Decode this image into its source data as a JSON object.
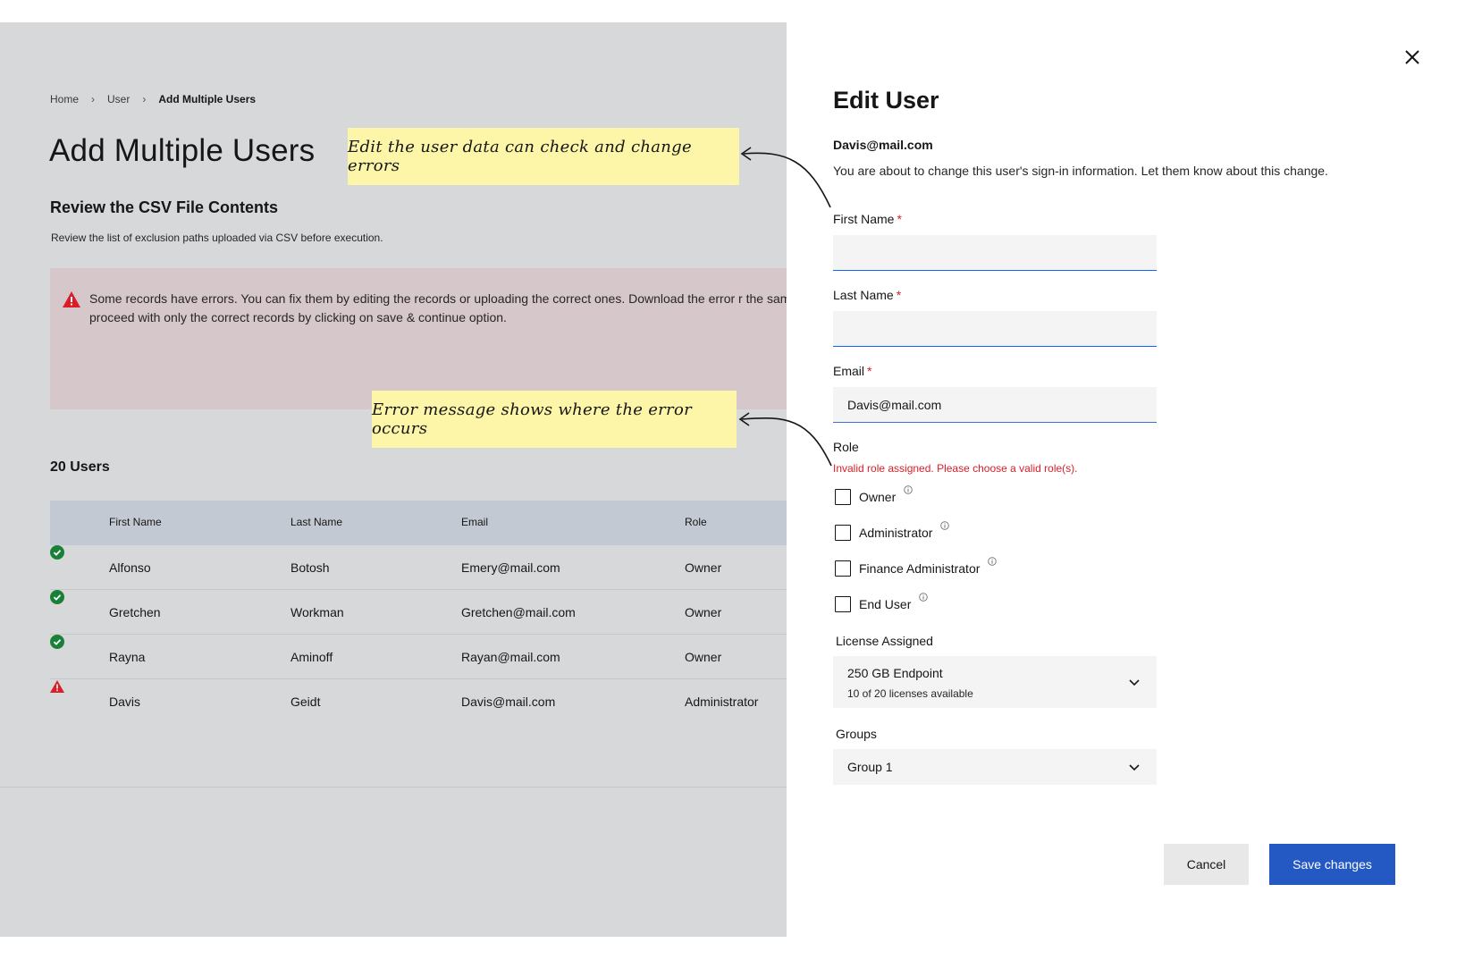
{
  "background_page": {
    "breadcrumb": {
      "home": "Home",
      "user": "User",
      "current": "Add Multiple Users"
    },
    "title": "Add Multiple Users",
    "section_title": "Review the CSV File Contents",
    "section_desc": "Review the list of exclusion paths uploaded via CSV before execution.",
    "error_banner_text": "Some records have errors. You can fix them by editing the records or uploading the correct ones. Download the error r the same file. You can proceed with only the correct records by clicking on save & continue option.",
    "users_count": "20 Users",
    "table": {
      "headers": [
        "First Name",
        "Last Name",
        "Email",
        "Role"
      ],
      "rows": [
        {
          "status": "success-icon",
          "first": "Alfonso",
          "last": "Botosh",
          "email": "Emery@mail.com",
          "role": "Owner"
        },
        {
          "status": "success-icon",
          "first": "Gretchen",
          "last": "Workman",
          "email": "Gretchen@mail.com",
          "role": "Owner"
        },
        {
          "status": "success-icon",
          "first": "Rayna",
          "last": "Aminoff",
          "email": "Rayan@mail.com",
          "role": "Owner"
        },
        {
          "status": "warning-icon",
          "first": "Davis",
          "last": "Geidt",
          "email": "Davis@mail.com",
          "role": "Administrator"
        }
      ]
    }
  },
  "annotations": {
    "note1": "Edit the user data can check and change errors",
    "note2": "Error message shows where the error occurs"
  },
  "panel": {
    "title": "Edit User",
    "email": "Davis@mail.com",
    "description": "You are about to change this user's sign-in information. Let them know about this change.",
    "first_name_label": "First Name",
    "first_name_value": "",
    "last_name_label": "Last Name",
    "last_name_value": "",
    "email_label": "Email",
    "email_value": "Davis@mail.com",
    "required_mark": "*",
    "role_label": "Role",
    "role_error": "Invalid role assigned. Please choose a valid role(s).",
    "roles": [
      "Owner",
      "Administrator",
      "Finance Administrator",
      "End User"
    ],
    "license_label": "License Assigned",
    "license_value": "250 GB Endpoint",
    "license_sub": "10 of 20 licenses available",
    "groups_label": "Groups",
    "groups_value": "Group 1",
    "cancel_label": "Cancel",
    "save_label": "Save changes"
  },
  "colors": {
    "primary": "#2459c4",
    "error": "#da1e28",
    "success": "#198038",
    "note": "#fdf6a8"
  }
}
